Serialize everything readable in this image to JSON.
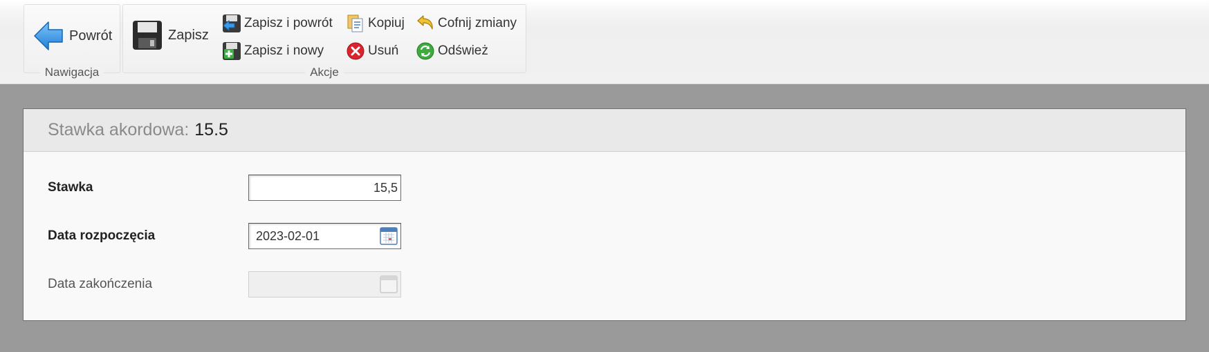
{
  "toolbar": {
    "navigation_group": "Nawigacja",
    "actions_group": "Akcje",
    "back_label": "Powrót",
    "save_label": "Zapisz",
    "save_and_back_label": "Zapisz i powrót",
    "save_and_new_label": "Zapisz i nowy",
    "copy_label": "Kopiuj",
    "delete_label": "Usuń",
    "undo_label": "Cofnij zmiany",
    "refresh_label": "Odśwież",
    "icons": {
      "back": "arrow-left-icon",
      "save": "floppy-disk-icon",
      "save_and_back": "save-return-icon",
      "save_and_new": "save-new-icon",
      "copy": "copy-icon",
      "delete": "delete-icon",
      "undo": "undo-icon",
      "refresh": "refresh-icon"
    }
  },
  "panel": {
    "title_label": "Stawka akordowa:",
    "title_value": "15.5"
  },
  "form": {
    "rate": {
      "label": "Stawka",
      "value": "15,5"
    },
    "start_date": {
      "label": "Data rozpoczęcia",
      "value": "2023-02-01"
    },
    "end_date": {
      "label": "Data zakończenia",
      "value": ""
    }
  },
  "colors": {
    "background": "#9a9a9a",
    "panel_header": "#e9e9e9",
    "accent_blue": "#2a8de0"
  }
}
